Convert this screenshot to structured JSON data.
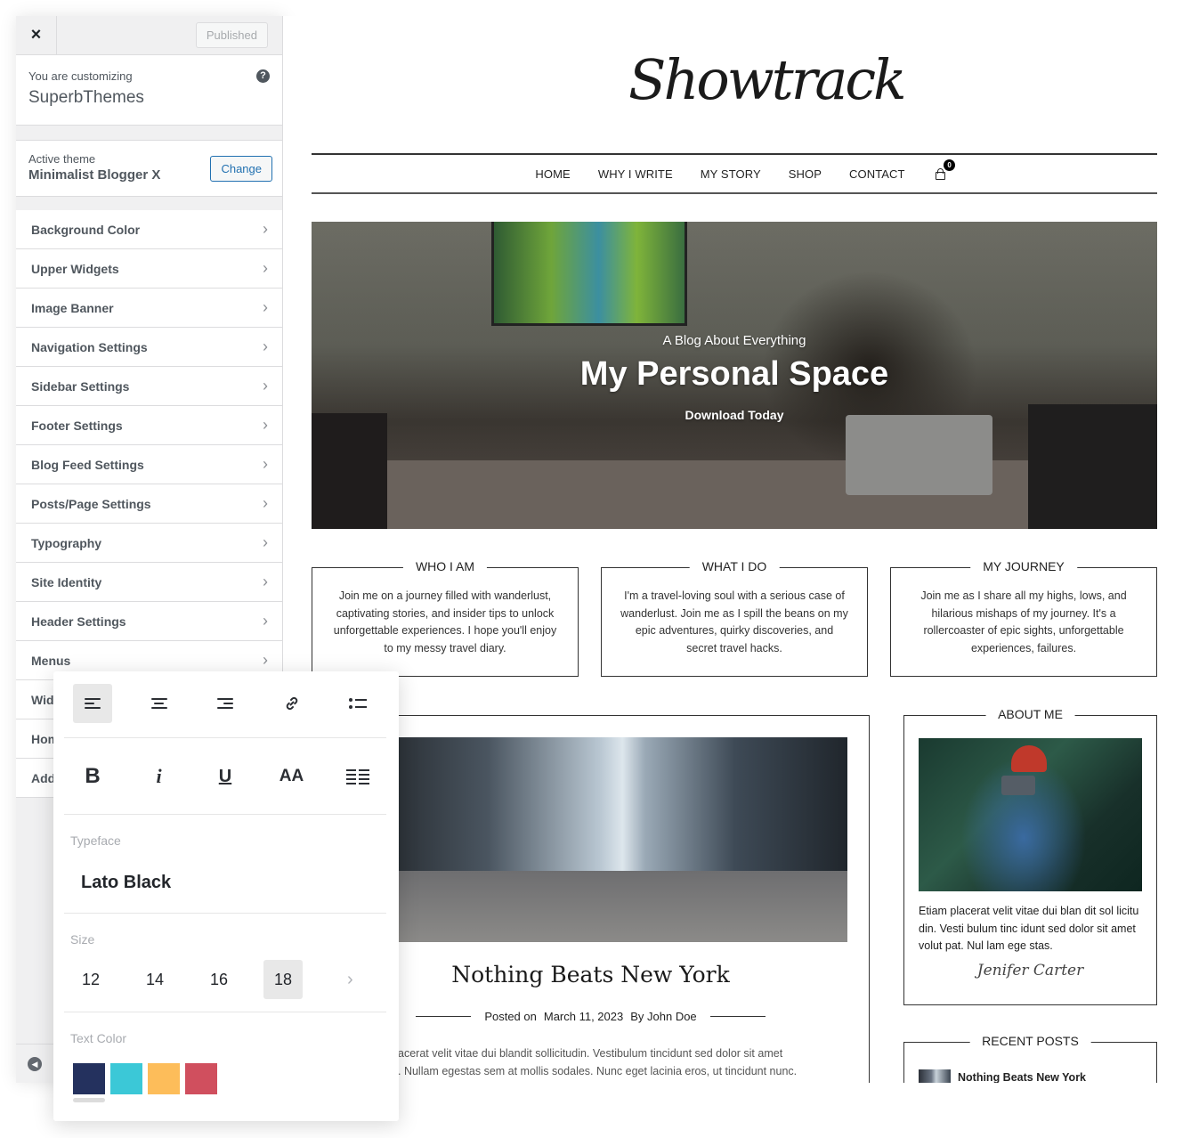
{
  "customizer": {
    "close_label": "×",
    "publish_label": "Published",
    "info_small": "You are customizing",
    "info_site": "SuperbThemes",
    "help_label": "?",
    "theme_small": "Active theme",
    "theme_name": "Minimalist Blogger X",
    "change_label": "Change",
    "items": [
      {
        "label": "Background Color"
      },
      {
        "label": "Upper Widgets"
      },
      {
        "label": "Image Banner"
      },
      {
        "label": "Navigation Settings"
      },
      {
        "label": "Sidebar Settings"
      },
      {
        "label": "Footer Settings"
      },
      {
        "label": "Blog Feed Settings"
      },
      {
        "label": "Posts/Page Settings"
      },
      {
        "label": "Typography"
      },
      {
        "label": "Site Identity"
      },
      {
        "label": "Header Settings"
      },
      {
        "label": "Menus"
      },
      {
        "label": "Widgets"
      },
      {
        "label": "Homepage Settings"
      },
      {
        "label": "Additional CSS"
      }
    ],
    "chevron": "›",
    "collapse_icon": "◀"
  },
  "site": {
    "logo": "Showtrack",
    "nav": [
      "HOME",
      "WHY I WRITE",
      "MY STORY",
      "SHOP",
      "CONTACT"
    ],
    "cart_count": "0",
    "hero": {
      "subtitle": "A Blog About Everything",
      "title": "My Personal Space",
      "button": "Download Today"
    },
    "boxes": [
      {
        "title": "WHO I AM",
        "text": "Join me on a journey filled with wanderlust, captivating stories, and insider tips to unlock unforgettable experiences. I hope you'll enjoy to my messy travel diary."
      },
      {
        "title": "WHAT I DO",
        "text": "I'm a travel-loving soul with a serious case of wanderlust. Join me as I spill the beans on my epic adventures, quirky discoveries, and secret travel hacks."
      },
      {
        "title": "MY JOURNEY",
        "text": "Join me as I share all my highs, lows, and hilarious mishaps of my journey. It's a rollercoaster of epic sights, unforgettable experiences, failures."
      }
    ],
    "post": {
      "title": "Nothing Beats New York",
      "posted_on": "Posted on",
      "date": "March 11, 2023",
      "author": "By John Doe",
      "excerpt_line1": "acerat velit vitae dui blandit sollicitudin. Vestibulum tincidunt sed dolor sit amet",
      "excerpt_line2": ". Nullam egestas sem at mollis sodales. Nunc eget lacinia eros, ut tincidunt nunc."
    },
    "about": {
      "title": "ABOUT ME",
      "text": "Etiam placerat velit vitae dui blan dit sol licitu din. Vesti bulum tinc idunt sed dolor sit amet volut pat. Nul lam ege stas.",
      "signature": "Jenifer Carter"
    },
    "recent": {
      "title": "RECENT POSTS",
      "items": [
        "Nothing Beats New York"
      ]
    }
  },
  "panel": {
    "typeface_label": "Typeface",
    "typeface_value": "Lato Black",
    "size_label": "Size",
    "sizes": [
      "12",
      "14",
      "16",
      "18"
    ],
    "selected_size": "18",
    "size_next": "›",
    "color_label": "Text Color",
    "tools_row2": {
      "bold": "B",
      "italic": "i",
      "underline": "U",
      "caps": "AA"
    },
    "colors": [
      "#24315e",
      "#3bc8d7",
      "#fdbd5a",
      "#d04f5e"
    ],
    "selected_color": "#24315e"
  }
}
